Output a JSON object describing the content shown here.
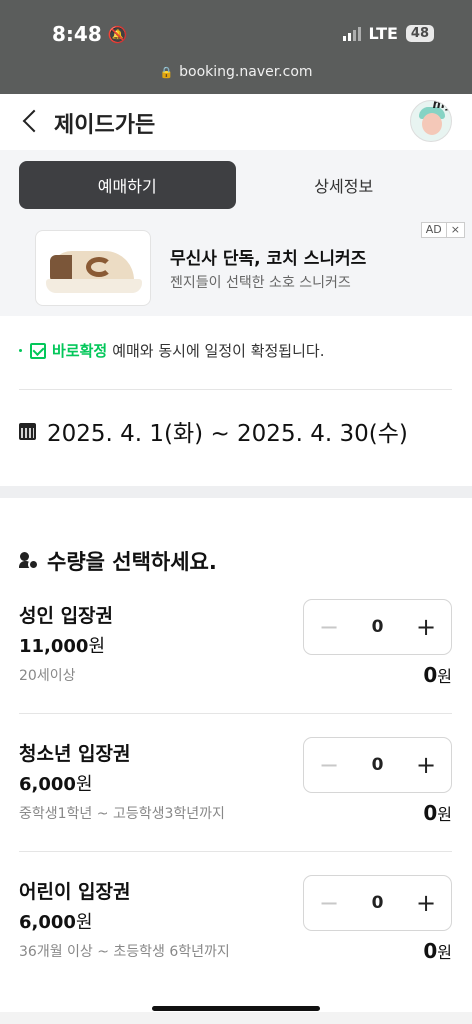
{
  "status_bar": {
    "time": "8:48",
    "network": "LTE",
    "battery": "48"
  },
  "browser": {
    "url": "booking.naver.com"
  },
  "header": {
    "title": "제이드가든",
    "avatar_badge": "my"
  },
  "tabs": [
    {
      "label": "예매하기",
      "active": true
    },
    {
      "label": "상세정보",
      "active": false
    }
  ],
  "ad": {
    "title": "무신사 단독, 코치 스니커즈",
    "subtitle": "젠지들이 선택한 소호 스니커즈",
    "badge": "AD",
    "close": "×"
  },
  "confirm": {
    "highlight": "바로확정",
    "text": "예매와 동시에 일정이 확정됩니다."
  },
  "dates": {
    "range": "2025. 4. 1(화) ~ 2025. 4. 30(수)"
  },
  "quantity": {
    "title": "수량을 선택하세요.",
    "tickets": [
      {
        "name": "성인 입장권",
        "price": "11,000",
        "unit": "원",
        "desc": "20세이상",
        "count": "0",
        "total": "0",
        "minus": "−",
        "plus": "+"
      },
      {
        "name": "청소년 입장권",
        "price": "6,000",
        "unit": "원",
        "desc": "중학생1학년 ~ 고등학생3학년까지",
        "count": "0",
        "total": "0",
        "minus": "−",
        "plus": "+"
      },
      {
        "name": "어린이 입장권",
        "price": "6,000",
        "unit": "원",
        "desc": "36개월 이상 ~ 초등학생 6학년까지",
        "count": "0",
        "total": "0",
        "minus": "−",
        "plus": "+"
      }
    ]
  },
  "colors": {
    "accent_green": "#03c75a",
    "tab_active": "#3e3f42"
  }
}
